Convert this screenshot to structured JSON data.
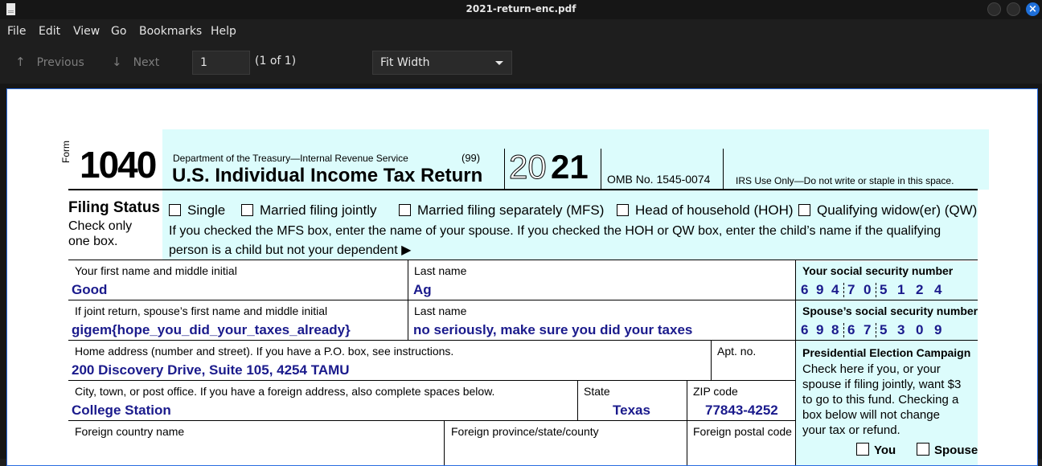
{
  "window": {
    "title": "2021-return-enc.pdf"
  },
  "menu": [
    "File",
    "Edit",
    "View",
    "Go",
    "Bookmarks",
    "Help"
  ],
  "toolbar": {
    "previous": "Previous",
    "next": "Next",
    "page_value": "1",
    "page_count": "(1 of 1)",
    "zoom": "Fit Width"
  },
  "form": {
    "form_word": "Form",
    "number": "1040",
    "dept": "Department of the Treasury—Internal Revenue Service",
    "code99": "(99)",
    "title": "U.S. Individual Income Tax Return",
    "year_outline": "20",
    "year_bold": "21",
    "omb": "OMB No. 1545-0074",
    "irs_use": "IRS Use Only—Do not write or staple in this space.",
    "filing_status_title": "Filing Status",
    "filing_status_sub1": "Check only",
    "filing_status_sub2": "one box.",
    "opt_single": "Single",
    "opt_mfj": "Married filing jointly",
    "opt_mfs": "Married filing separately (MFS)",
    "opt_hoh": "Head of household (HOH)",
    "opt_qw": "Qualifying widow(er) (QW)",
    "mfs_note_1": "If you checked the MFS box, enter the name of your spouse. If you checked the HOH or QW box, enter the child’s name if the qualifying",
    "mfs_note_2": "person is a child but not your dependent",
    "arrow": "▶",
    "lbl_first": "Your first name and middle initial",
    "lbl_last": "Last name",
    "lbl_ssn": "Your social security number",
    "first_name": "Good",
    "last_name": "Ag",
    "ssn": [
      "6",
      "9",
      "4",
      "7",
      "0",
      "5",
      "1",
      "2",
      "4"
    ],
    "lbl_sp_first": "If joint return, spouse’s first name and middle initial",
    "lbl_sp_last": "Last name",
    "lbl_sp_ssn": "Spouse’s social security number",
    "sp_first": "gigem{hope_you_did_your_taxes_already}",
    "sp_last": "no seriously, make sure you did your taxes",
    "sp_ssn": [
      "6",
      "9",
      "8",
      "6",
      "7",
      "5",
      "3",
      "0",
      "9"
    ],
    "lbl_address": "Home address (number and street). If you have a P.O. box, see instructions.",
    "lbl_apt": "Apt. no.",
    "address": "200 Discovery Drive, Suite 105, 4254 TAMU",
    "lbl_city": "City, town, or post office. If you have a foreign address, also complete spaces below.",
    "lbl_state": "State",
    "lbl_zip": "ZIP code",
    "city": "College Station",
    "state": "Texas",
    "zip": "77843-4252",
    "lbl_country": "Foreign country name",
    "lbl_province": "Foreign province/state/county",
    "lbl_postal": "Foreign postal code",
    "pec_title": "Presidential Election Campaign",
    "pec_l1": "Check here if you, or your",
    "pec_l2": "spouse if filing jointly, want $3",
    "pec_l3": "to go to this fund. Checking a",
    "pec_l4": "box below will not change",
    "pec_l5": "your tax or refund.",
    "pec_you": "You",
    "pec_spouse": "Spouse"
  }
}
